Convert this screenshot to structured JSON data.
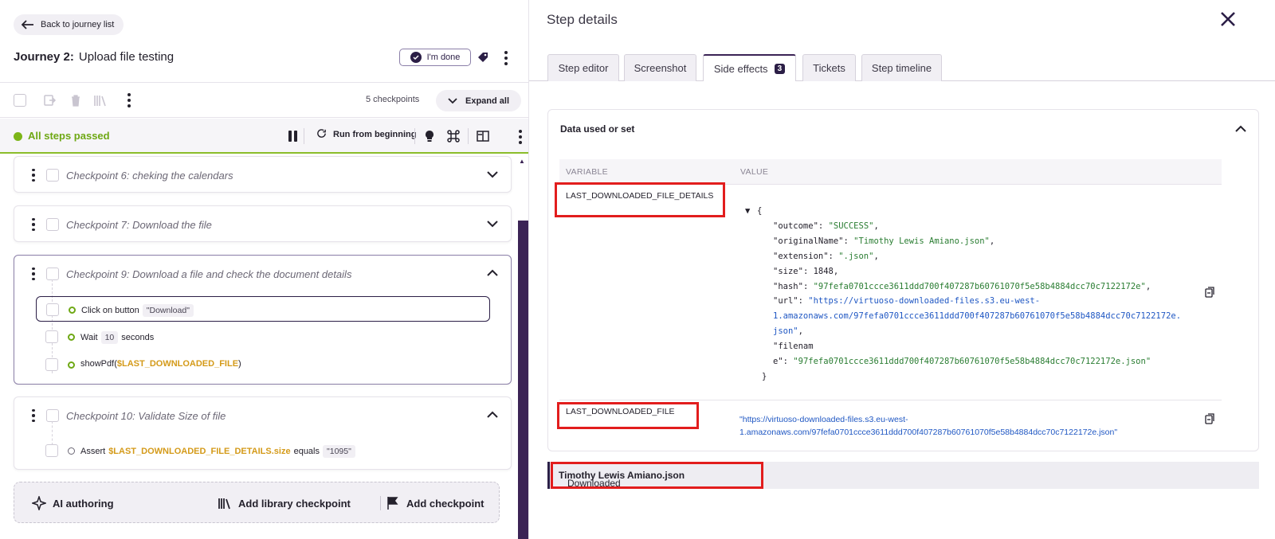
{
  "left": {
    "back_label": "Back to journey list",
    "journey_prefix": "Journey 2:",
    "journey_name": "Upload file testing",
    "done_label": "I'm done",
    "checkpoints_count": "5 checkpoints",
    "expand_all": "Expand all",
    "status": "All steps passed",
    "run_label": "Run from beginning",
    "checkpoints": [
      {
        "title": "Checkpoint 6:  cheking the calendars"
      },
      {
        "title": "Checkpoint 7:  Download the file"
      },
      {
        "title": "Checkpoint 9:  Download a file and check the document details"
      },
      {
        "title": "Checkpoint 10:  Validate Size of file"
      }
    ],
    "cp9_steps": {
      "s1_text": "Click on button",
      "s1_pill": "\"Download\"",
      "s2_text": "Wait",
      "s2_pill": "10",
      "s2_suffix": "seconds",
      "s3_prefix": "showPdf(",
      "s3_var": "$LAST_DOWNLOADED_FILE",
      "s3_suffix": ")"
    },
    "cp10_step": {
      "prefix": "Assert",
      "var": "$LAST_DOWNLOADED_FILE_DETAILS.size",
      "op": "equals",
      "pill": "\"1095\""
    },
    "bottom": {
      "ai": "AI authoring",
      "library": "Add library checkpoint",
      "add": "Add checkpoint"
    }
  },
  "right": {
    "title": "Step details",
    "tabs": [
      "Step editor",
      "Screenshot",
      "Side effects",
      "Tickets",
      "Step timeline"
    ],
    "side_effects_count": "3",
    "active_tab": "Side effects",
    "section_title": "Data used or set",
    "col_variable": "VARIABLE",
    "col_value": "VALUE",
    "var1": "LAST_DOWNLOADED_FILE_DETAILS",
    "var2": "LAST_DOWNLOADED_FILE",
    "json_lines": {
      "open": "{",
      "outcome_k": "\"outcome\"",
      "outcome_v": "\"SUCCESS\"",
      "orig_k": "\"originalName\"",
      "orig_v": "\"Timothy Lewis Amiano.json\"",
      "ext_k": "\"extension\"",
      "ext_v": "\".json\"",
      "size_k": "\"size\"",
      "size_v": "1848",
      "hash_k": "\"hash\"",
      "hash_v": "\"97fefa0701ccce3611ddd700f407287b60761070f5e58b4884dcc70c7122172e\"",
      "url_k": "\"url\"",
      "url_v1": "\"https://virtuoso-downloaded-files.s3.eu-west-",
      "url_v2": "1.amazonaws.com/97fefa0701ccce3611ddd700f407287b60761070f5e58b4884dcc70c7122172e.",
      "url_v3": "json\"",
      "fn_k1": "\"filenam",
      "fn_k2": "e\"",
      "fn_v": "\"97fefa0701ccce3611ddd700f407287b60761070f5e58b4884dcc70c7122172e.json\"",
      "close": "}"
    },
    "var2_value_l1": "\"https://virtuoso-downloaded-files.s3.eu-west-",
    "var2_value_l2": "1.amazonaws.com/97fefa0701ccce3611ddd700f407287b60761070f5e58b4884dcc70c7122172e.json\"",
    "log_prefix": "Downloaded",
    "log_name": "Timothy Lewis Amiano.json",
    "log_suffix": "."
  },
  "colors": {
    "brand": "#2b1e46",
    "success": "#6ea814",
    "variable": "#d49a19",
    "highlight": "#e21d1d"
  }
}
